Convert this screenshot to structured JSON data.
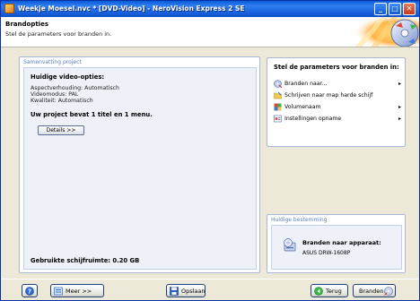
{
  "window": {
    "title": "Weekje Moesel.nvc * [DVD-Video] - NeroVision Express 2 SE"
  },
  "header": {
    "title": "Brandopties",
    "subtitle": "Stel de parameters voor branden in."
  },
  "summary": {
    "section_label": "Samenvatting project",
    "current_options_heading": "Huidige video-opties:",
    "aspect_ratio": "Aspectverhouding: Automatisch",
    "video_mode": "Videomodus: PAL",
    "quality": "Kwaliteit: Automatisch",
    "project_info": "Uw project bevat 1 titel en 1 menu.",
    "details_button": "Details >>",
    "disk_space": "Gebruikte schijfruimte: 0.20 GB"
  },
  "burn_params": {
    "heading": "Stel de parameters voor branden in:",
    "items": [
      {
        "label": "Branden naar...",
        "icon": "burn-to-icon",
        "has_arrow": true
      },
      {
        "label": "Schrijven naar map harde schijf",
        "icon": "folder-icon",
        "has_arrow": false
      },
      {
        "label": "Volumenaam",
        "icon": "volume-name-icon",
        "has_arrow": true
      },
      {
        "label": "Instellingen opname",
        "icon": "record-settings-icon",
        "has_arrow": true
      }
    ],
    "arrow_glyph": "▸"
  },
  "destination": {
    "section_label": "Huidige bestemming",
    "title": "Branden naar apparaat:",
    "device": "ASUS    DRW-1608P"
  },
  "footer": {
    "more_label": "Meer >>",
    "save_label": "Opslaan",
    "back_label": "Terug",
    "burn_label": "Branden"
  },
  "titlebar_buttons": {
    "minimize": "_",
    "maximize": "□",
    "close": "✕"
  },
  "colors": {
    "titlebar": "#1a64e0",
    "panel_border": "#a9b6d6",
    "section_label": "#5a7fbd"
  }
}
